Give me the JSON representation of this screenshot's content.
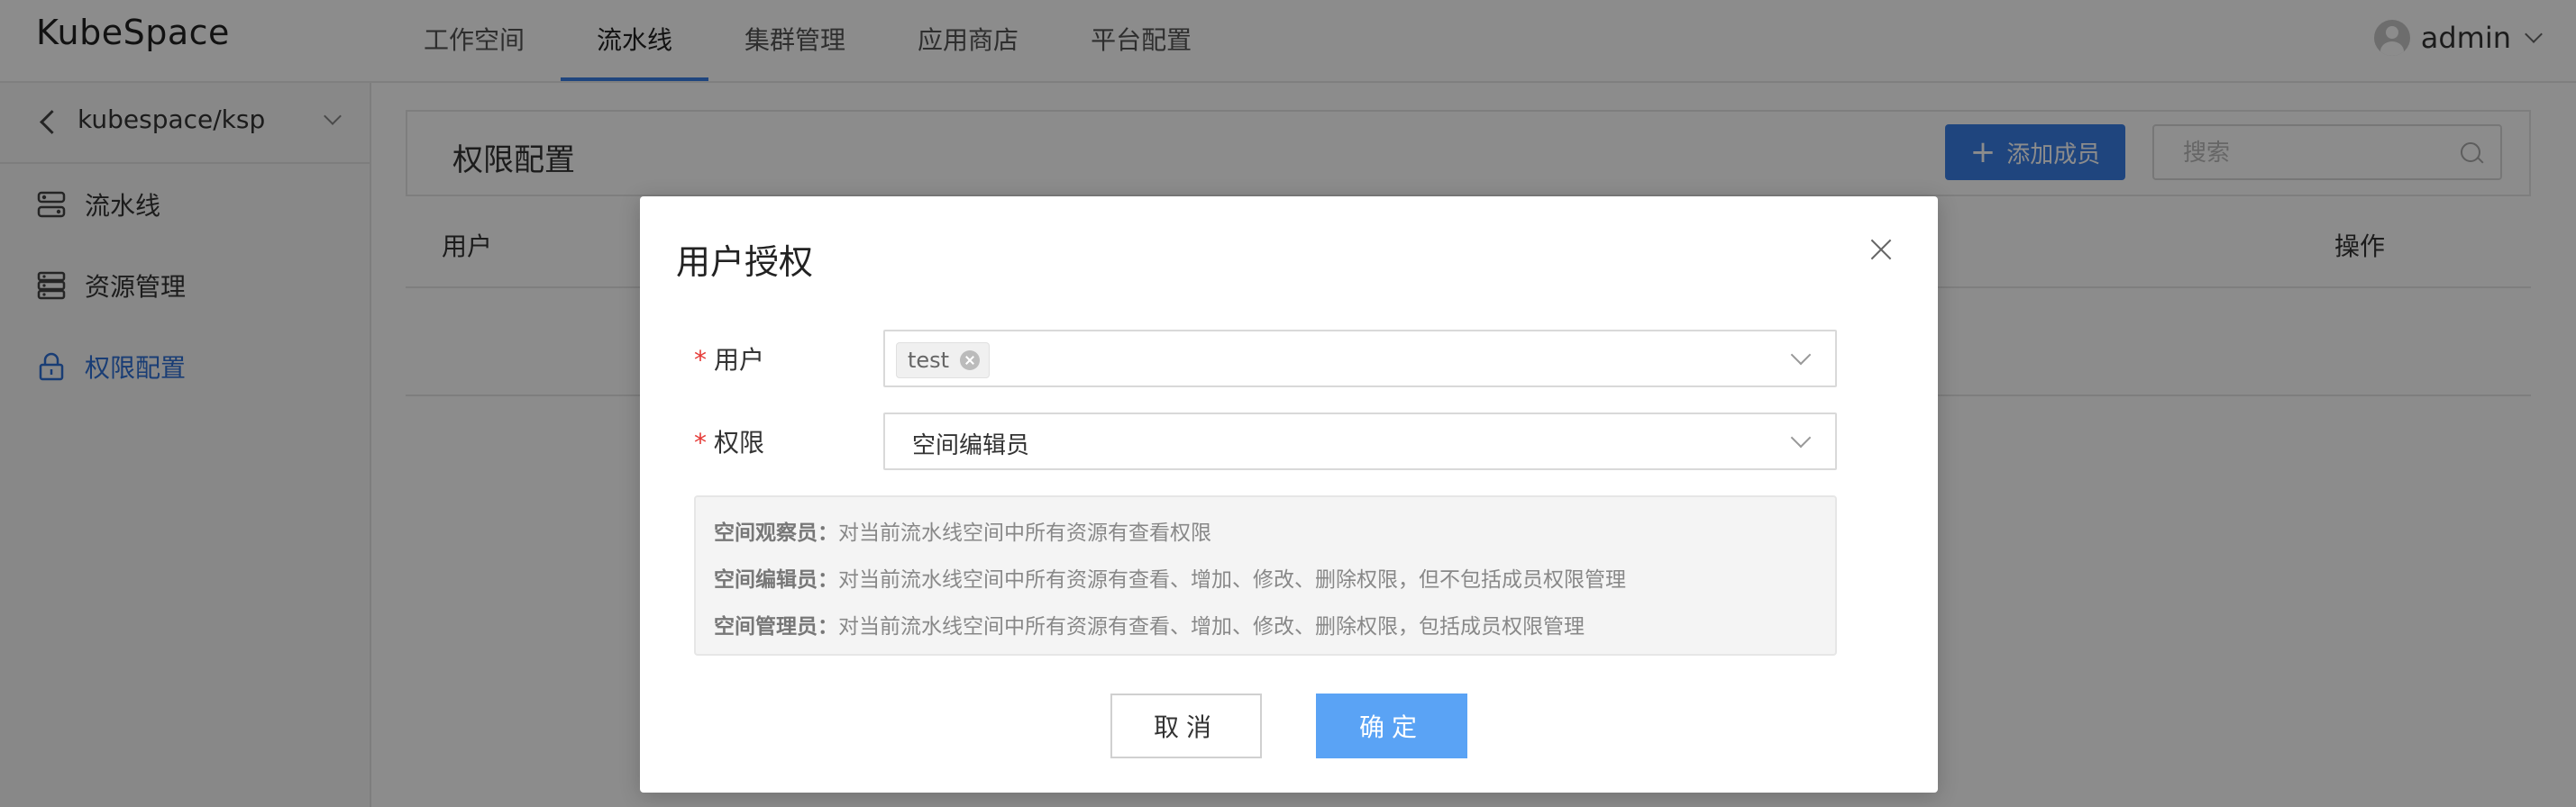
{
  "header": {
    "logo": "KubeSpace",
    "tabs": [
      {
        "label": "工作空间"
      },
      {
        "label": "流水线"
      },
      {
        "label": "集群管理"
      },
      {
        "label": "应用商店"
      },
      {
        "label": "平台配置"
      }
    ],
    "active_tab": "流水线",
    "username": "admin"
  },
  "sidebar": {
    "workspace": "kubespace/ksp",
    "items": [
      {
        "label": "流水线",
        "icon": "pipeline-icon"
      },
      {
        "label": "资源管理",
        "icon": "server-icon"
      },
      {
        "label": "权限配置",
        "icon": "lock-icon"
      }
    ],
    "active_item": "权限配置"
  },
  "main": {
    "title": "权限配置",
    "add_button": "添加成员",
    "search_placeholder": "搜索",
    "columns": {
      "user": "用户",
      "op": "操作"
    }
  },
  "modal": {
    "title": "用户授权",
    "user_label": "用户",
    "user_tag": "test",
    "permission_label": "权限",
    "permission_value": "空间编辑员",
    "descriptions": [
      {
        "role": "空间观察员：",
        "text": "对当前流水线空间中所有资源有查看权限"
      },
      {
        "role": "空间编辑员：",
        "text": "对当前流水线空间中所有资源有查看、增加、修改、删除权限，但不包括成员权限管理"
      },
      {
        "role": "空间管理员：",
        "text": "对当前流水线空间中所有资源有查看、增加、修改、删除权限，包括成员权限管理"
      }
    ],
    "cancel": "取消",
    "ok": "确定"
  },
  "colors": {
    "accent": "#3a7ee6",
    "ok_button": "#5aa3f5",
    "required": "#e53935"
  }
}
